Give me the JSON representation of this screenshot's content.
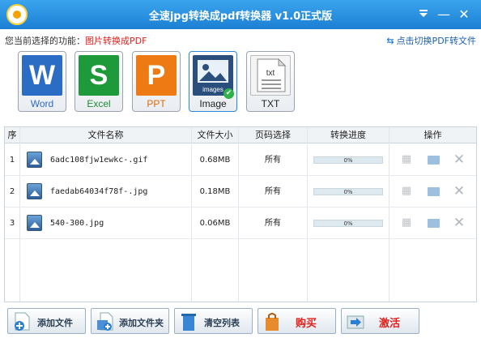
{
  "window": {
    "title": "全速jpg转换成pdf转换器 v1.0正式版",
    "menu_icon": "chevron-down-icon",
    "min_label": "—",
    "close_label": "✕"
  },
  "function_bar": {
    "label": "您当前选择的功能：",
    "current": "图片转换成PDF",
    "switch_label": "点击切换PDF转文件",
    "switch_icon": "⇆"
  },
  "tiles": [
    {
      "caption": "Word",
      "glyph": "W",
      "color": "#2b6cc4"
    },
    {
      "caption": "Excel",
      "glyph": "S",
      "color": "#1f9a3a"
    },
    {
      "caption": "PPT",
      "glyph": "P",
      "color": "#ee7a14"
    },
    {
      "caption": "Image",
      "glyph": "images",
      "color": "#2a4f7c",
      "selected": true
    },
    {
      "caption": "TXT",
      "glyph": "txt",
      "color": "#e9e9e9"
    }
  ],
  "table": {
    "headers": [
      "序",
      "文件名称",
      "文件大小",
      "页码选择",
      "转换进度",
      "操作"
    ],
    "rows": [
      {
        "index": "1",
        "name": "6adc108fjw1ewkc-.gif",
        "size": "0.68MB",
        "pages": "所有",
        "progress": "0%"
      },
      {
        "index": "2",
        "name": "faedab64034f78f-.jpg",
        "size": "0.18MB",
        "pages": "所有",
        "progress": "0%"
      },
      {
        "index": "3",
        "name": "540-300.jpg",
        "size": "0.06MB",
        "pages": "所有",
        "progress": "0%"
      }
    ]
  },
  "buttons": {
    "add_file": "添加文件",
    "add_folder": "添加文件夹",
    "clear_list": "清空列表",
    "buy": "购买",
    "activate": "激活"
  }
}
